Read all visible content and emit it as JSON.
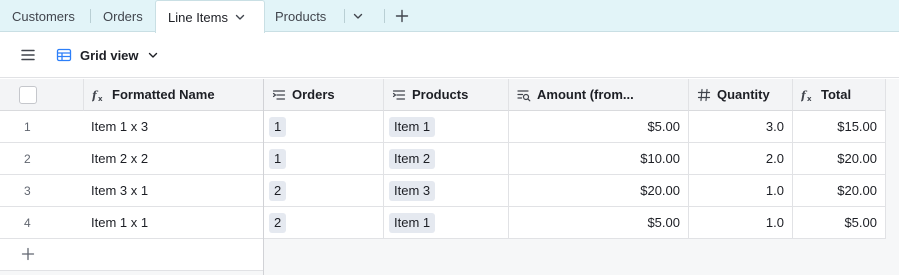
{
  "tabs": [
    {
      "label": "Customers"
    },
    {
      "label": "Orders"
    },
    {
      "label": "Line Items",
      "active": true
    },
    {
      "label": "Products"
    }
  ],
  "toolbar": {
    "view_label": "Grid view",
    "menu_icon": "hamburger-icon",
    "view_icon": "grid-icon"
  },
  "columns": [
    {
      "label": "Formatted Name",
      "icon": "formula-icon"
    },
    {
      "label": "Orders",
      "icon": "link-icon"
    },
    {
      "label": "Products",
      "icon": "link-icon"
    },
    {
      "label": "Amount (from...",
      "icon": "lookup-icon"
    },
    {
      "label": "Quantity",
      "icon": "number-icon"
    },
    {
      "label": "Total",
      "icon": "formula-icon"
    }
  ],
  "rows": [
    {
      "num": "1",
      "name": "Item 1 x 3",
      "order": "1",
      "product": "Item 1",
      "amount": "$5.00",
      "quantity": "3.0",
      "total": "$15.00"
    },
    {
      "num": "2",
      "name": "Item 2 x 2",
      "order": "1",
      "product": "Item 2",
      "amount": "$10.00",
      "quantity": "2.0",
      "total": "$20.00"
    },
    {
      "num": "3",
      "name": "Item 3 x 1",
      "order": "2",
      "product": "Item 3",
      "amount": "$20.00",
      "quantity": "1.0",
      "total": "$20.00"
    },
    {
      "num": "4",
      "name": "Item 1 x 1",
      "order": "2",
      "product": "Item 1",
      "amount": "$5.00",
      "quantity": "1.0",
      "total": "$5.00"
    }
  ],
  "colors": {
    "tabbar_bg": "#e2f4f8",
    "header_bg": "#f3f4f6",
    "chip_bg": "#e5e9f0",
    "accent": "#2d7ff9"
  }
}
